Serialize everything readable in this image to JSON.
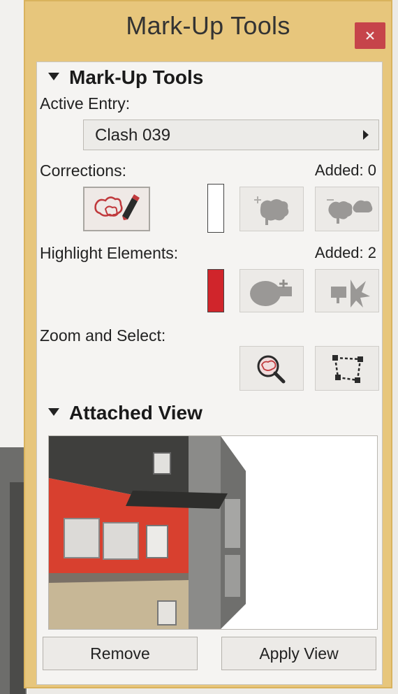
{
  "window": {
    "title": "Mark-Up Tools"
  },
  "markup": {
    "section_title": "Mark-Up Tools",
    "active_entry_label": "Active Entry:",
    "active_entry_value": "Clash 039",
    "corrections_label": "Corrections:",
    "corrections_added": "Added: 0",
    "highlight_label": "Highlight Elements:",
    "highlight_added": "Added: 2",
    "highlight_color": "#d0252b",
    "zoom_label": "Zoom and Select:"
  },
  "attached_view": {
    "section_title": "Attached View"
  },
  "buttons": {
    "remove": "Remove",
    "apply_view": "Apply View"
  },
  "icons": {
    "close": "close-icon",
    "draw_correction": "draw-cloud-pen-icon",
    "add_correction": "add-cloud-icon",
    "remove_correction": "remove-cloud-icon",
    "add_highlight": "add-highlight-icon",
    "remove_highlight": "remove-highlight-icon",
    "zoom": "zoom-magnifier-icon",
    "select": "select-bounding-icon"
  }
}
